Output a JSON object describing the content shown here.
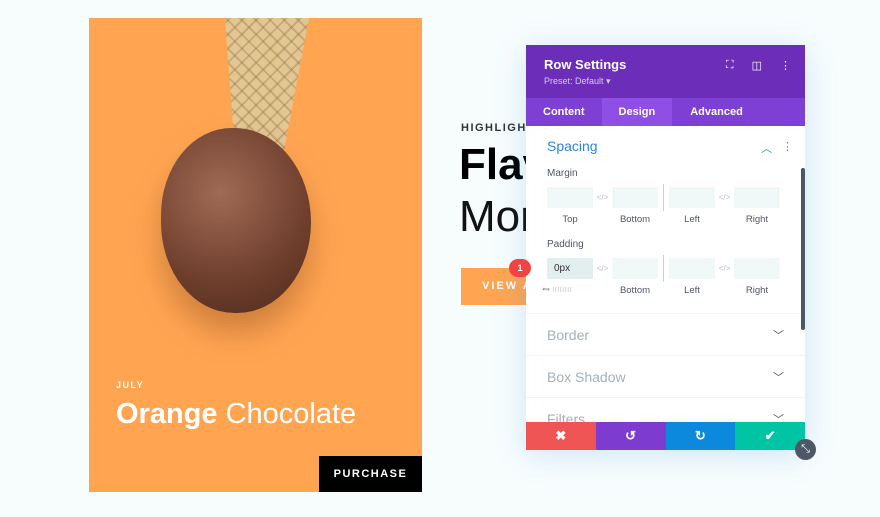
{
  "card": {
    "month": "JULY",
    "title_bold": "Orange",
    "title_light": "Chocolate",
    "button": "PURCHASE"
  },
  "hero": {
    "eyebrow": "HIGHLIGHT",
    "line1": "Flav",
    "line2": "Mon",
    "button": "VIEW A"
  },
  "panel": {
    "title": "Row Settings",
    "preset": "Preset: Default ▾",
    "tabs": [
      "Content",
      "Design",
      "Advanced"
    ],
    "active_tab": "Design",
    "spacing": {
      "title": "Spacing",
      "margin": {
        "label": "Margin",
        "fields": [
          {
            "label": "Top",
            "value": ""
          },
          {
            "label": "Bottom",
            "value": ""
          },
          {
            "label": "Left",
            "value": ""
          },
          {
            "label": "Right",
            "value": ""
          }
        ]
      },
      "padding": {
        "label": "Padding",
        "fields": [
          {
            "label": "Top",
            "value": "0px"
          },
          {
            "label": "Bottom",
            "value": ""
          },
          {
            "label": "Left",
            "value": ""
          },
          {
            "label": "Right",
            "value": ""
          }
        ]
      }
    },
    "sections": [
      "Border",
      "Box Shadow",
      "Filters"
    ]
  },
  "annotation": "1",
  "colors": {
    "orange": "#ffa552",
    "purple": "#6c2eb9",
    "cancel": "#ef5555",
    "undo": "#7e3bd0",
    "redo": "#0c88dc",
    "save": "#00c4a3"
  }
}
